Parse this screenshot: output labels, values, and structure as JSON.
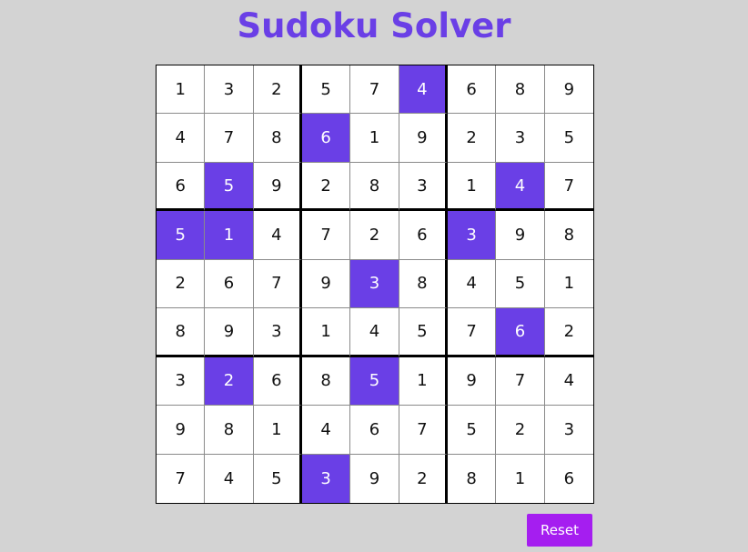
{
  "title": "Sudoku Solver",
  "reset_label": "Reset",
  "colors": {
    "background": "#d3d3d3",
    "accent": "#6a3fe6",
    "given_cell_bg": "#6a3fe6",
    "reset_button_bg": "#a51ef0"
  },
  "board": [
    [
      "1",
      "3",
      "2",
      "5",
      "7",
      "4",
      "6",
      "8",
      "9"
    ],
    [
      "4",
      "7",
      "8",
      "6",
      "1",
      "9",
      "2",
      "3",
      "5"
    ],
    [
      "6",
      "5",
      "9",
      "2",
      "8",
      "3",
      "1",
      "4",
      "7"
    ],
    [
      "5",
      "1",
      "4",
      "7",
      "2",
      "6",
      "3",
      "9",
      "8"
    ],
    [
      "2",
      "6",
      "7",
      "9",
      "3",
      "8",
      "4",
      "5",
      "1"
    ],
    [
      "8",
      "9",
      "3",
      "1",
      "4",
      "5",
      "7",
      "6",
      "2"
    ],
    [
      "3",
      "2",
      "6",
      "8",
      "5",
      "1",
      "9",
      "7",
      "4"
    ],
    [
      "9",
      "8",
      "1",
      "4",
      "6",
      "7",
      "5",
      "2",
      "3"
    ],
    [
      "7",
      "4",
      "5",
      "3",
      "9",
      "2",
      "8",
      "1",
      "6"
    ]
  ],
  "given_cells": [
    [
      0,
      5
    ],
    [
      1,
      3
    ],
    [
      2,
      1
    ],
    [
      2,
      7
    ],
    [
      3,
      0
    ],
    [
      3,
      1
    ],
    [
      3,
      6
    ],
    [
      4,
      4
    ],
    [
      5,
      7
    ],
    [
      6,
      1
    ],
    [
      6,
      4
    ],
    [
      8,
      3
    ]
  ]
}
